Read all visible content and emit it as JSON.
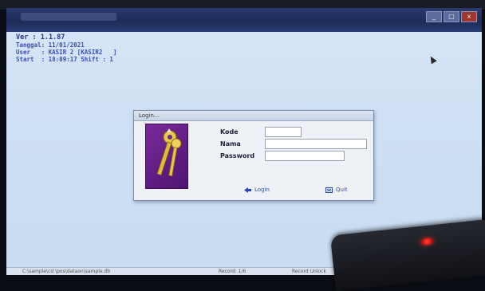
{
  "header": {
    "version": "Ver : 1.1.87",
    "tanggal_line": "Tanggal: 11/01/2021",
    "user_line": "User   : KASIR 2 [KASIR2   ]",
    "start_line": "Start  : 18:09:17 Shift : 1"
  },
  "window_controls": {
    "minimize": "_",
    "maximize": "□",
    "close": "x"
  },
  "login": {
    "title": "Login...",
    "kode_label": "Kode",
    "nama_label": "Nama",
    "password_label": "Password",
    "kode_value": "",
    "nama_value": "",
    "password_value": "",
    "login_button": "Login",
    "quit_button": "Quit"
  },
  "statusbar": {
    "left": "C:\\sample\\cd \\pos\\dataon\\sample.db",
    "mid": "Record: 1/6",
    "right": "Record Unlock"
  },
  "colors": {
    "accent": "#3a4fb6",
    "title_bar": "#1f2c58",
    "desktop": "#cfe0f4"
  }
}
